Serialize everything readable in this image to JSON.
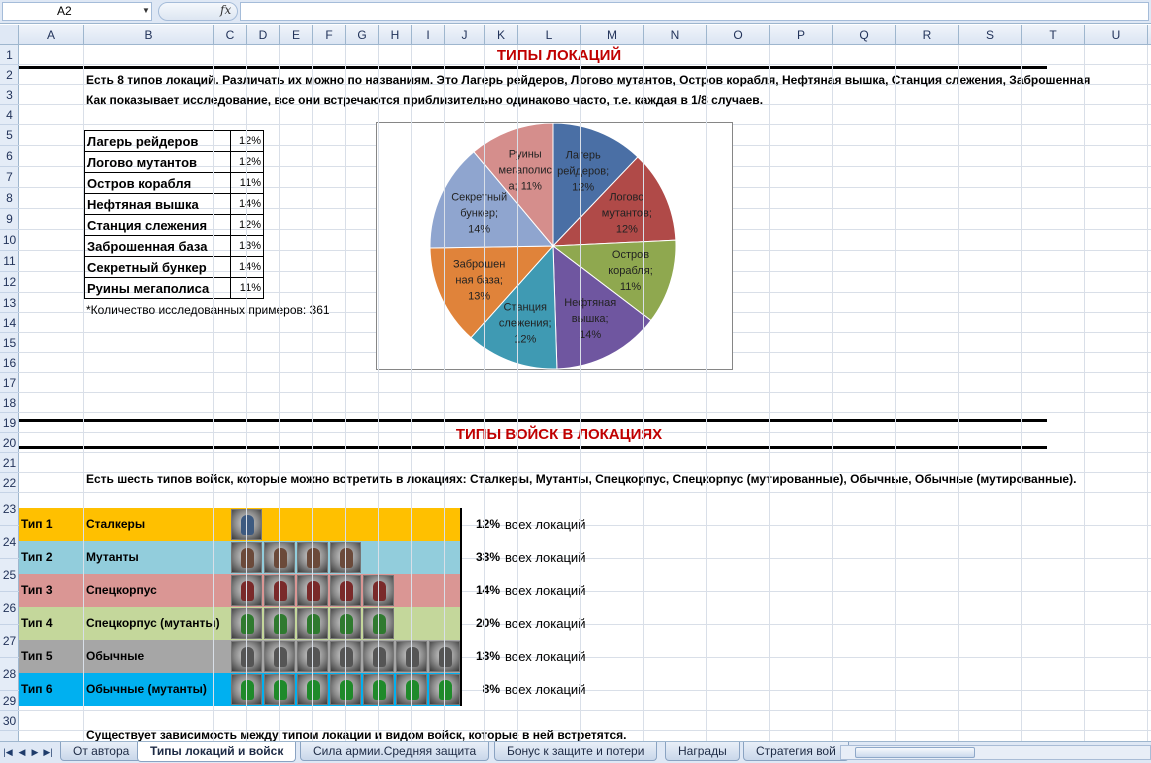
{
  "formula_bar": {
    "name_box": "A2",
    "fx": "fx",
    "formula": ""
  },
  "columns": [
    "A",
    "B",
    "C",
    "D",
    "E",
    "F",
    "G",
    "H",
    "I",
    "J",
    "K",
    "L",
    "M",
    "N",
    "O",
    "P",
    "Q",
    "R",
    "S",
    "T",
    "U"
  ],
  "rows": [
    "1",
    "2",
    "3",
    "4",
    "5",
    "6",
    "7",
    "8",
    "9",
    "10",
    "11",
    "12",
    "13",
    "14",
    "15",
    "16",
    "17",
    "18",
    "19",
    "20",
    "21",
    "22",
    "23",
    "24",
    "25",
    "26",
    "27",
    "28",
    "29",
    "30"
  ],
  "section1": {
    "title": "ТИПЫ ЛОКАЦИЙ",
    "line1": "Есть 8 типов локаций. Различать их можно по названиям. Это Лагерь рейдеров, Логово мутантов, Остров корабля, Нефтяная вышка, Станция слежения, Заброшенная",
    "line2": "Как показывает исследование, все они встречаются приблизительно одинаково часто, т.е. каждая в 1/8 случаев.",
    "locations": [
      {
        "name": "Лагерь рейдеров",
        "pct": "12%"
      },
      {
        "name": "Логово мутантов",
        "pct": "12%"
      },
      {
        "name": "Остров корабля",
        "pct": "11%"
      },
      {
        "name": "Нефтяная вышка",
        "pct": "14%"
      },
      {
        "name": "Станция слежения",
        "pct": "12%"
      },
      {
        "name": "Заброшенная база",
        "pct": "13%"
      },
      {
        "name": "Секретный бункер",
        "pct": "14%"
      },
      {
        "name": "Руины мегаполиса",
        "pct": "11%"
      }
    ],
    "footnote": "*Количество исследованных примеров: 361"
  },
  "chart_data": {
    "type": "pie",
    "categories": [
      "Лагерь рейдеров",
      "Логово мутантов",
      "Остров корабля",
      "Нефтяная вышка",
      "Станция слежения",
      "Заброшенная база",
      "Секретный бункер",
      "Руины мегаполиса"
    ],
    "values": [
      12,
      12,
      11,
      14,
      12,
      13,
      14,
      11
    ],
    "colors": [
      "#4a6fa5",
      "#b04a48",
      "#8fa84f",
      "#6f56a0",
      "#3f9ab3",
      "#e0833a",
      "#8fa5cf",
      "#d58e8c"
    ],
    "slice_labels": [
      [
        "Лагерь",
        "рейдеров;",
        "12%"
      ],
      [
        "Логово",
        "мутантов;",
        "12%"
      ],
      [
        "Остров",
        "корабля;",
        "11%"
      ],
      [
        "Нефтяная",
        "вышка;",
        "14%"
      ],
      [
        "Станция",
        "слежения;",
        "12%"
      ],
      [
        "Заброшен",
        "ная база;",
        "13%"
      ],
      [
        "Секретный",
        "бункер;",
        "14%"
      ],
      [
        "Руины",
        "мегаполис",
        "а; 11%"
      ]
    ],
    "title": "",
    "legend": "none"
  },
  "section2": {
    "title": "ТИПЫ ВОЙСК В ЛОКАЦИЯХ",
    "intro": "Есть шесть типов войск, которые можно встретить в локациях: Сталкеры, Мутанты, Спецкорпус, Спецкорпус (мутированные), Обычные, Обычные (мутированные).",
    "troops": [
      {
        "type": "Тип 1",
        "name": "Сталкеры",
        "pct": "12%",
        "suffix": "всех локаций",
        "color": "#ffc000",
        "icons": 1
      },
      {
        "type": "Тип 2",
        "name": "Мутанты",
        "pct": "33%",
        "suffix": "всех локаций",
        "color": "#92cddc",
        "icons": 4
      },
      {
        "type": "Тип 3",
        "name": "Спецкорпус",
        "pct": "14%",
        "suffix": "всех локаций",
        "color": "#da9694",
        "icons": 5
      },
      {
        "type": "Тип 4",
        "name": "Спецкорпус (мутанты)",
        "pct": "20%",
        "suffix": "всех локаций",
        "color": "#c4d79b",
        "icons": 5
      },
      {
        "type": "Тип 5",
        "name": "Обычные",
        "pct": "13%",
        "suffix": "всех локаций",
        "color": "#a6a6a6",
        "icons": 7
      },
      {
        "type": "Тип 6",
        "name": "Обычные (мутанты)",
        "pct": "8%",
        "suffix": "всех локаций",
        "color": "#00b0f0",
        "icons": 7
      }
    ],
    "dependency": "Существует зависимость между типом локации и видом войск, которые в ней встретятся."
  },
  "tabs": [
    {
      "label": "От автора"
    },
    {
      "label": "Типы локаций и войск"
    },
    {
      "label": "Сила армии.Средняя защита"
    },
    {
      "label": "Бонус к защите и потери"
    },
    {
      "label": "Награды"
    },
    {
      "label": "Стратегия вой"
    }
  ]
}
